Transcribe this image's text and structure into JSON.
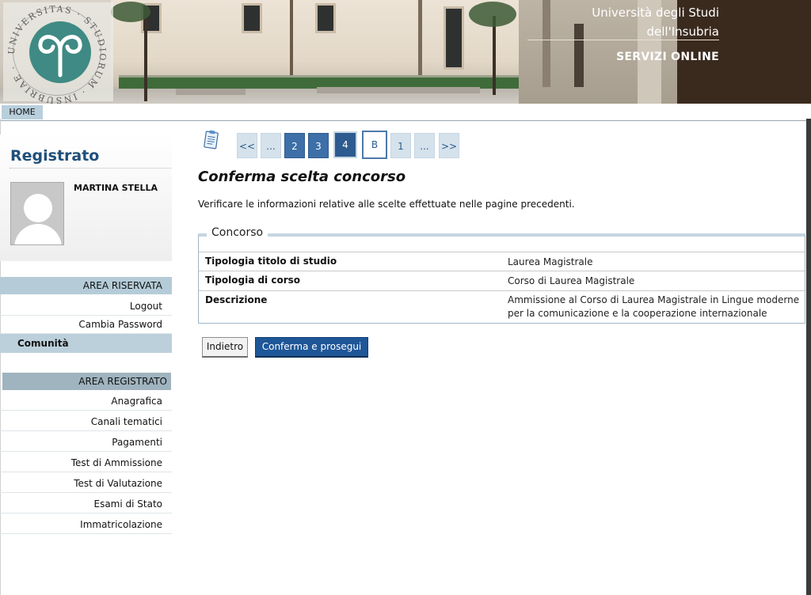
{
  "header": {
    "university_line1": "Università degli Studi",
    "university_line2": "dell'Insubria",
    "servizi": "SERVIZI ONLINE",
    "logo_icon": "university-seal-icon"
  },
  "nav": {
    "home": "HOME"
  },
  "sidebar": {
    "title": "Registrato",
    "user_name": "MARTINA STELLA",
    "area_riservata": {
      "heading": "AREA RISERVATA",
      "items": [
        {
          "label": "Logout"
        },
        {
          "label": "Cambia Password"
        },
        {
          "label": "Comunità",
          "active": true
        }
      ]
    },
    "area_registrato": {
      "heading": "AREA REGISTRATO",
      "items": [
        {
          "label": "Anagrafica"
        },
        {
          "label": "Canali tematici"
        },
        {
          "label": "Pagamenti"
        },
        {
          "label": "Test di Ammissione"
        },
        {
          "label": "Test di Valutazione"
        },
        {
          "label": "Esami di Stato"
        },
        {
          "label": "Immatricolazione"
        }
      ]
    }
  },
  "steps": {
    "first": "<<",
    "ellipsis_left": "...",
    "s2": "2",
    "s3": "3",
    "s4": "4",
    "current": "B",
    "s1": "1",
    "ellipsis_right": "...",
    "last": ">>"
  },
  "main": {
    "title": "Conferma scelta concorso",
    "description": "Verificare le informazioni relative alle scelte effettuate nelle pagine precedenti.",
    "section_legend": "Concorso",
    "rows": [
      {
        "label": "Tipologia titolo di studio",
        "value": "Laurea Magistrale"
      },
      {
        "label": "Tipologia di corso",
        "value": "Corso di Laurea Magistrale"
      },
      {
        "label": "Descrizione",
        "value": "Ammissione al Corso di Laurea Magistrale in Lingue moderne per la comunicazione e la cooperazione internazionale"
      }
    ],
    "back_button": "Indietro",
    "confirm_button": "Conferma e prosegui"
  },
  "colors": {
    "title_blue": "#1f4f7a",
    "step_done": "#3d6fa8",
    "confirm_button": "#1e5697",
    "section_header": "#b5ccd8"
  }
}
